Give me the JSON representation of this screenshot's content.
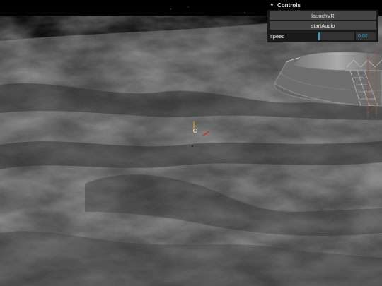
{
  "controls": {
    "title": "Controls",
    "collapse_icon": "chevron-down-icon",
    "buttons": {
      "launch_vr": "launchVR",
      "start_audio": "startAudio"
    },
    "speed": {
      "label": "speed",
      "value": "0.02",
      "fraction": 0.02
    }
  },
  "colors": {
    "slider_accent": "#2fa1d6",
    "panel_bg": "#1a1a1a",
    "button_bg": "#444444"
  },
  "scene": {
    "description_icons": [
      "moon-surface",
      "lunar-lander-base",
      "launch-tower",
      "gizmo-marker"
    ]
  }
}
